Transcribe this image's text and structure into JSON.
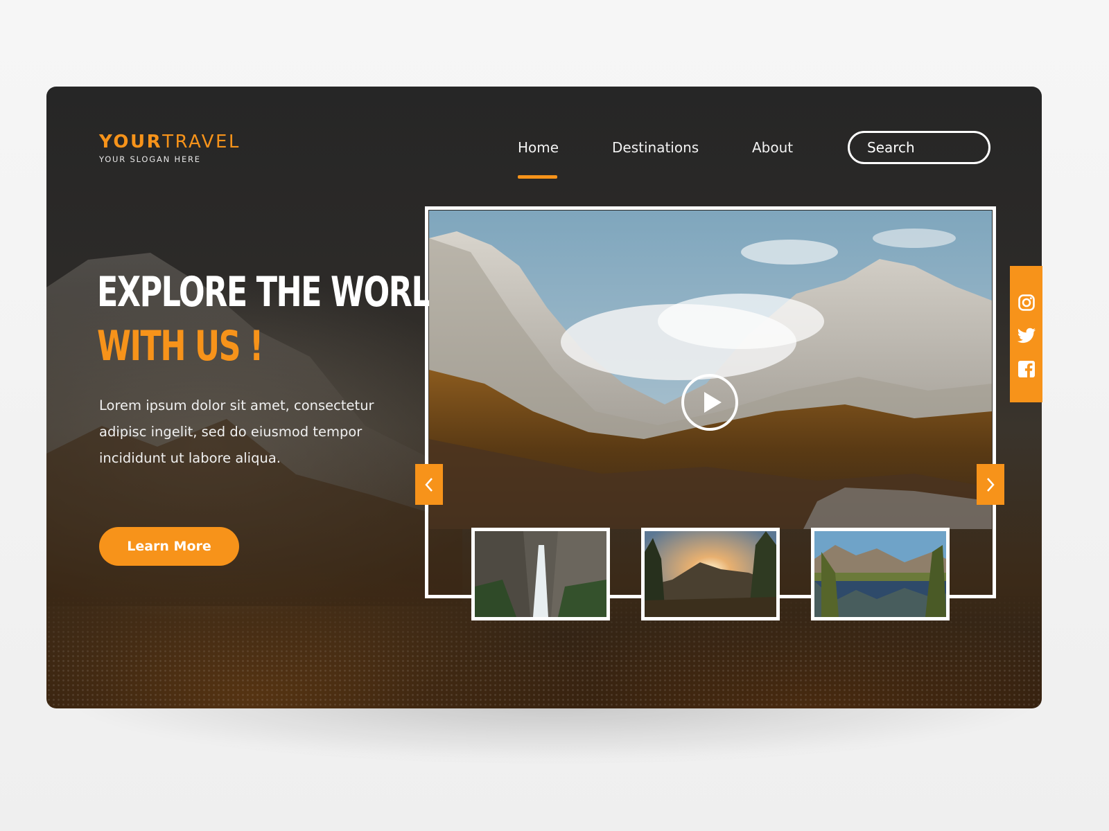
{
  "logo": {
    "bold": "YOUR",
    "light": "TRAVEL",
    "slogan": "YOUR SLOGAN HERE"
  },
  "nav": {
    "items": [
      {
        "label": "Home",
        "active": true
      },
      {
        "label": "Destinations",
        "active": false
      },
      {
        "label": "About",
        "active": false
      }
    ],
    "search_placeholder": "Search"
  },
  "hero": {
    "line1": "EXPLORE THE WORLD",
    "line2": "WITH US !",
    "body": "Lorem ipsum dolor sit amet, consectetur adipisc ingelit, sed do eiusmod tempor incididunt ut labore aliqua.",
    "cta_label": "Learn More"
  },
  "slider": {
    "main_image": "mountain-valley-photo",
    "play_icon": "play-icon",
    "prev_icon": "chevron-left-icon",
    "next_icon": "chevron-right-icon",
    "thumbnails": [
      "waterfall-photo",
      "forest-sunset-photo",
      "lake-reflection-photo"
    ]
  },
  "social": {
    "icons": [
      "instagram-icon",
      "twitter-icon",
      "facebook-icon"
    ]
  },
  "colors": {
    "accent": "#f7931a",
    "background": "#262626",
    "text": "#ffffff"
  }
}
